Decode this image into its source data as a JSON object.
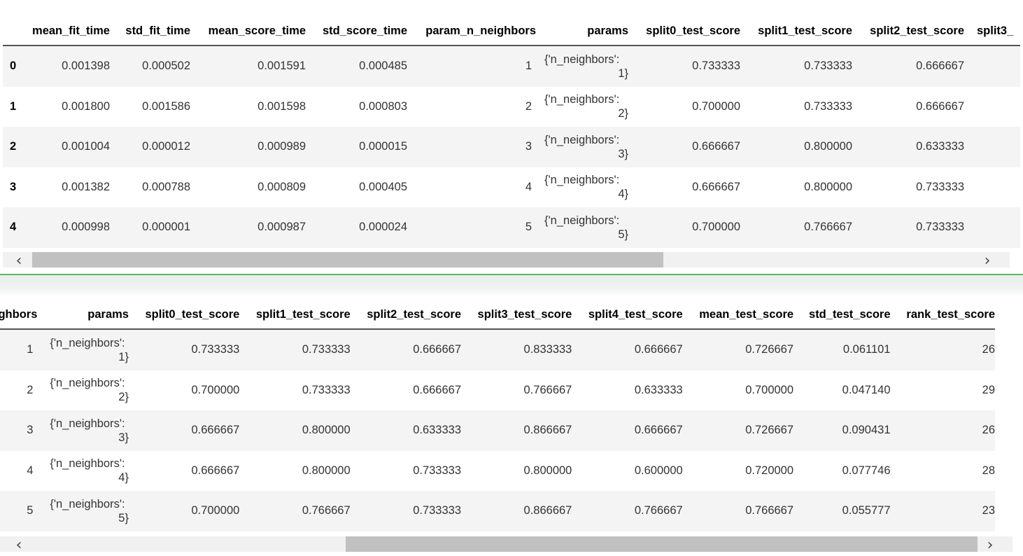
{
  "top_table": {
    "columns": [
      "",
      "mean_fit_time",
      "std_fit_time",
      "mean_score_time",
      "std_score_time",
      "param_n_neighbors",
      "params",
      "split0_test_score",
      "split1_test_score",
      "split2_test_score",
      "split3_"
    ],
    "rows": [
      {
        "index": "0",
        "mean_fit_time": "0.001398",
        "std_fit_time": "0.000502",
        "mean_score_time": "0.001591",
        "std_score_time": "0.000485",
        "param_n_neighbors": "1",
        "params_line1": "{'n_neighbors':",
        "params_line2": "1}",
        "split0": "0.733333",
        "split1": "0.733333",
        "split2": "0.666667"
      },
      {
        "index": "1",
        "mean_fit_time": "0.001800",
        "std_fit_time": "0.001586",
        "mean_score_time": "0.001598",
        "std_score_time": "0.000803",
        "param_n_neighbors": "2",
        "params_line1": "{'n_neighbors':",
        "params_line2": "2}",
        "split0": "0.700000",
        "split1": "0.733333",
        "split2": "0.666667"
      },
      {
        "index": "2",
        "mean_fit_time": "0.001004",
        "std_fit_time": "0.000012",
        "mean_score_time": "0.000989",
        "std_score_time": "0.000015",
        "param_n_neighbors": "3",
        "params_line1": "{'n_neighbors':",
        "params_line2": "3}",
        "split0": "0.666667",
        "split1": "0.800000",
        "split2": "0.633333"
      },
      {
        "index": "3",
        "mean_fit_time": "0.001382",
        "std_fit_time": "0.000788",
        "mean_score_time": "0.000809",
        "std_score_time": "0.000405",
        "param_n_neighbors": "4",
        "params_line1": "{'n_neighbors':",
        "params_line2": "4}",
        "split0": "0.666667",
        "split1": "0.800000",
        "split2": "0.733333"
      },
      {
        "index": "4",
        "mean_fit_time": "0.000998",
        "std_fit_time": "0.000001",
        "mean_score_time": "0.000987",
        "std_score_time": "0.000024",
        "param_n_neighbors": "5",
        "params_line1": "{'n_neighbors':",
        "params_line2": "5}",
        "split0": "0.700000",
        "split1": "0.766667",
        "split2": "0.733333"
      }
    ],
    "scroll_left_icon": "‹",
    "scroll_right_icon": "›"
  },
  "bottom_table": {
    "columns": [
      "ghbors",
      "params",
      "split0_test_score",
      "split1_test_score",
      "split2_test_score",
      "split3_test_score",
      "split4_test_score",
      "mean_test_score",
      "std_test_score",
      "rank_test_score"
    ],
    "rows": [
      {
        "param_n_neighbors": "1",
        "params_line1": "{'n_neighbors':",
        "params_line2": "1}",
        "split0": "0.733333",
        "split1": "0.733333",
        "split2": "0.666667",
        "split3": "0.833333",
        "split4": "0.666667",
        "mean_test_score": "0.726667",
        "std_test_score": "0.061101",
        "rank_test_score": "26"
      },
      {
        "param_n_neighbors": "2",
        "params_line1": "{'n_neighbors':",
        "params_line2": "2}",
        "split0": "0.700000",
        "split1": "0.733333",
        "split2": "0.666667",
        "split3": "0.766667",
        "split4": "0.633333",
        "mean_test_score": "0.700000",
        "std_test_score": "0.047140",
        "rank_test_score": "29"
      },
      {
        "param_n_neighbors": "3",
        "params_line1": "{'n_neighbors':",
        "params_line2": "3}",
        "split0": "0.666667",
        "split1": "0.800000",
        "split2": "0.633333",
        "split3": "0.866667",
        "split4": "0.666667",
        "mean_test_score": "0.726667",
        "std_test_score": "0.090431",
        "rank_test_score": "26"
      },
      {
        "param_n_neighbors": "4",
        "params_line1": "{'n_neighbors':",
        "params_line2": "4}",
        "split0": "0.666667",
        "split1": "0.800000",
        "split2": "0.733333",
        "split3": "0.800000",
        "split4": "0.600000",
        "mean_test_score": "0.720000",
        "std_test_score": "0.077746",
        "rank_test_score": "28"
      },
      {
        "param_n_neighbors": "5",
        "params_line1": "{'n_neighbors':",
        "params_line2": "5}",
        "split0": "0.700000",
        "split1": "0.766667",
        "split2": "0.733333",
        "split3": "0.866667",
        "split4": "0.766667",
        "mean_test_score": "0.766667",
        "std_test_score": "0.055777",
        "rank_test_score": "23"
      }
    ],
    "scroll_left_icon": "‹",
    "scroll_right_icon": "›"
  },
  "colors": {
    "divider": "#5cb85c",
    "row_stripe": "#f4f4f4",
    "scrollbar_thumb": "#c1c1c1"
  }
}
